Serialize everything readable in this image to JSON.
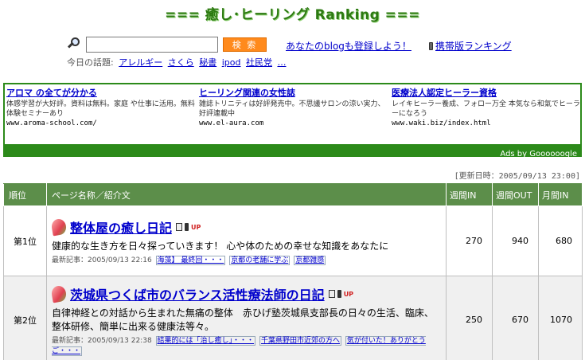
{
  "header": {
    "title": "=== 癒し･ヒーリング Ranking ==="
  },
  "search": {
    "placeholder": "",
    "button_label": "検 索",
    "register_link": "あなたのblogも登録しよう！",
    "mobile_link": "携帯版ランキング"
  },
  "topics": {
    "label": "今日の話題:",
    "items": [
      "アレルギー",
      "さくら",
      "秘書",
      "ipod",
      "社民党",
      "…"
    ]
  },
  "ads": {
    "items": [
      {
        "title": "アロマ の全てが分かる",
        "desc": "体感学習が大好評。資料は無料。家庭 や仕事に活用。無料体験セミナーあり",
        "url": "www.aroma-school.com/"
      },
      {
        "title": "ヒーリング関連の女性誌",
        "desc": "雑誌トリニティは好評発売中。不思議サロンの涼い実力、好評連載中",
        "url": "www.el-aura.com"
      },
      {
        "title": "医療法人認定ヒーラー資格",
        "desc": "レイキヒーラー養成、フォロー万全 本気なら和氣でヒーラーになろう",
        "url": "www.waki.biz/index.html"
      }
    ],
    "footer": "Ads by Goooooogle"
  },
  "updated": "[更新日時：2005/09/13 23:00]",
  "table": {
    "headers": [
      "順位",
      "ページ名称／紹介文",
      "週間IN",
      "週間OUT",
      "月間IN"
    ],
    "rows": [
      {
        "rank": "第1位",
        "title": "整体屋の癒し日記",
        "up": "UP",
        "desc": "健康的な生き方を日々探っていきます！ 心や体のための幸せな知識をあなたに",
        "recent_label": "最新記事：2005/09/13 22:16",
        "tags": [
          "海藻】 最終回・・・",
          "京都の老舗に学ぶ",
          "京都雑感"
        ],
        "week_in": "270",
        "week_out": "940",
        "month_in": "680"
      },
      {
        "rank": "第2位",
        "title": "茨城県つくば市のバランス活性療法師の日記",
        "up": "UP",
        "desc": "自律神経との対話から生まれた無痛の整体　赤ひげ塾茨城県支部長の日々の生活、臨床、整体研修、簡単に出来る健康法等々。",
        "recent_label": "最新記事：2005/09/13 22:38",
        "tags": [
          "結果的には「治し癒し」・・・",
          "千葉県野田市近郊の方へ",
          "気が付いた！ありがとうご・・・"
        ],
        "week_in": "250",
        "week_out": "670",
        "month_in": "1070"
      }
    ]
  }
}
